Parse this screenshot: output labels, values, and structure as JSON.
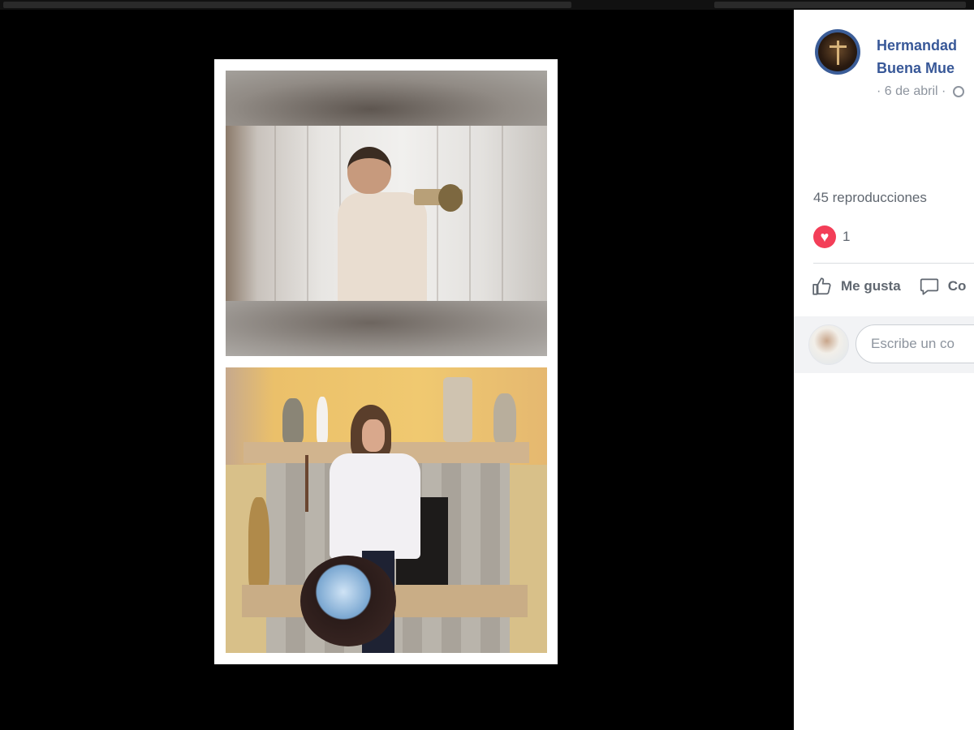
{
  "post": {
    "page_name_line1": "Hermandad",
    "page_name_line2": "Buena Mue",
    "date": "· 6 de abril ·",
    "views": "45 reproducciones",
    "reaction_count": "1",
    "like_label": "Me gusta",
    "comment_label": "Co",
    "comment_placeholder": "Escribe un co"
  },
  "icons": {
    "privacy": "globe-icon",
    "reaction": "love-icon",
    "like": "thumbs-up-icon",
    "comment": "comment-bubble-icon"
  },
  "colors": {
    "link": "#385898",
    "love": "#f33e58",
    "meta_text": "#8d949e",
    "action_text": "#606770"
  }
}
